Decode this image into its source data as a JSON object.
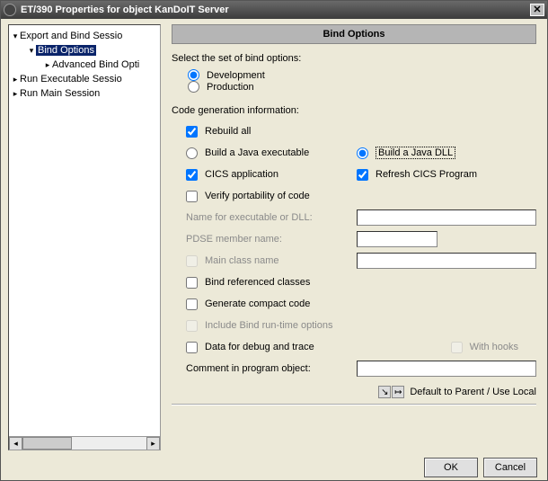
{
  "window": {
    "title": "ET/390 Properties for object KanDoIT Server"
  },
  "tree": {
    "items": [
      {
        "label": "Export and Bind Sessio",
        "depth": 0,
        "twist": "▾",
        "selected": false
      },
      {
        "label": "Bind Options",
        "depth": 1,
        "twist": "▾",
        "selected": true
      },
      {
        "label": "Advanced Bind Opti",
        "depth": 2,
        "twist": "▸",
        "selected": false
      },
      {
        "label": "Run Executable Sessio",
        "depth": 0,
        "twist": "▸",
        "selected": false
      },
      {
        "label": "Run Main Session",
        "depth": 0,
        "twist": "▸",
        "selected": false
      }
    ]
  },
  "panel": {
    "title": "Bind Options",
    "select_label": "Select the set of bind options:",
    "dev_label": "Development",
    "prod_label": "Production",
    "codegen_label": "Code generation information:",
    "rebuild_all": "Rebuild all",
    "build_exe": "Build a Java executable",
    "build_dll": "Build a Java DLL",
    "cics_app": "CICS application",
    "refresh_cics": "Refresh CICS Program",
    "verify_port": "Verify portability of code",
    "name_exe_dll": "Name for executable or DLL:",
    "pdse_name": "PDSE member name:",
    "main_class": "Main class name",
    "bind_ref": "Bind referenced classes",
    "gen_compact": "Generate compact code",
    "include_runtime": "Include Bind run-time options",
    "data_debug": "Data for debug and trace",
    "with_hooks": "With hooks",
    "comment_label": "Comment in program object:",
    "hint": "Default to Parent / Use Local",
    "name_value": "",
    "pdse_value": "",
    "main_value": "",
    "comment_value": ""
  },
  "buttons": {
    "ok": "OK",
    "cancel": "Cancel"
  }
}
